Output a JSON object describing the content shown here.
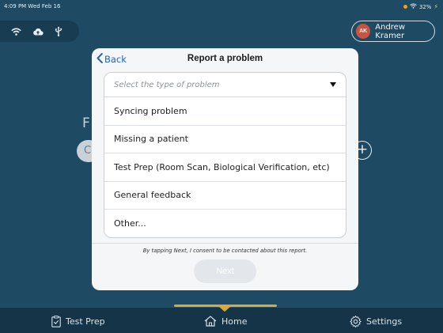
{
  "status_bar": {
    "time": "4:09 PM  Wed Feb 16",
    "battery": "32%"
  },
  "top_icons": [
    "wifi-icon",
    "cloud-upload-icon",
    "usb-icon"
  ],
  "user": {
    "initials": "AK",
    "name": "Andrew Kramer",
    "avatar_color": "#c8533f"
  },
  "background": {
    "partial_letter": "F",
    "partial_pill_letter": "C",
    "plus_symbol": "+"
  },
  "modal": {
    "back_label": "Back",
    "title": "Report a problem",
    "select_placeholder": "Select the type of problem",
    "options": [
      "Syncing problem",
      "Missing a patient",
      "Test Prep (Room Scan, Biological Verification, etc)",
      "General feedback",
      "Other..."
    ],
    "consent_text": "By tapping Next, I consent to be contacted about this report.",
    "next_label": "Next"
  },
  "tabs": [
    {
      "label": "Test Prep",
      "icon": "clipboard-check-icon",
      "active": false
    },
    {
      "label": "Home",
      "icon": "home-icon",
      "active": true
    },
    {
      "label": "Settings",
      "icon": "gear-icon",
      "active": false
    }
  ],
  "colors": {
    "background": "#1e4a63",
    "accent": "#d9a93c",
    "link": "#1f62c4"
  }
}
